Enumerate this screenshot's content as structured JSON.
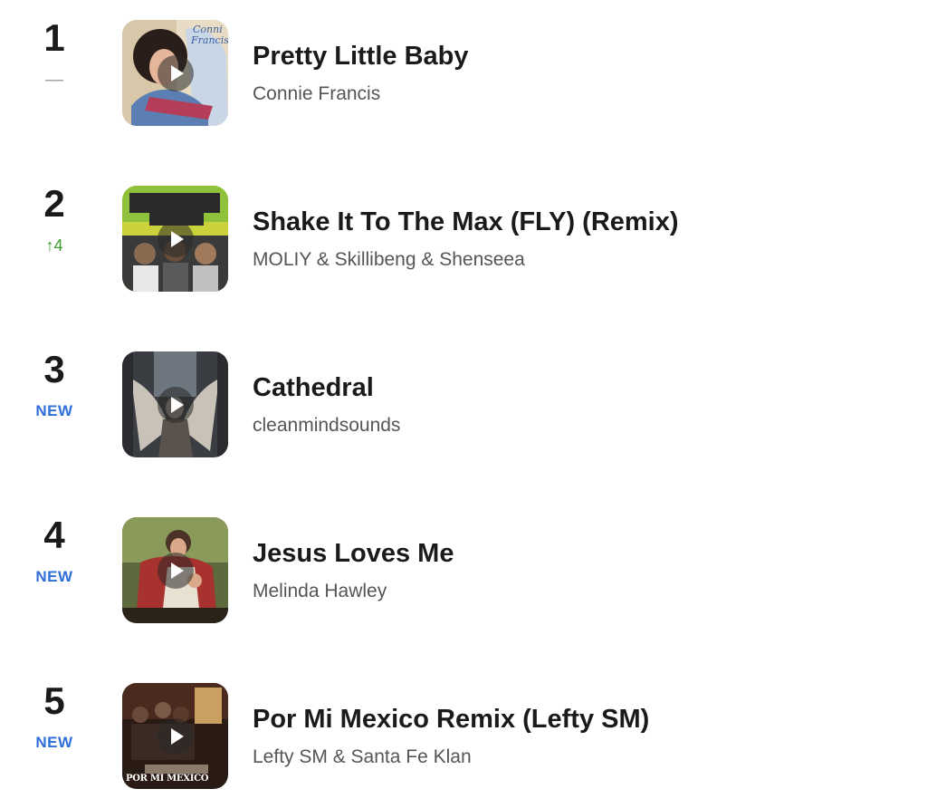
{
  "colors": {
    "rank_text": "#1a1a1a",
    "change_same": "#9a9a9a",
    "change_up": "#3a9a2a",
    "change_new": "#2f6fd8",
    "artist_text": "#555555"
  },
  "songs": [
    {
      "rank": "1",
      "change_label": "—",
      "change_type": "same",
      "title": "Pretty Little Baby",
      "artist": "Connie Francis",
      "artwork_icon": "play-icon"
    },
    {
      "rank": "2",
      "change_label": "↑4",
      "change_type": "up",
      "title": "Shake It To The Max (FLY) (Remix)",
      "artist": "MOLIY & Skillibeng & Shenseea",
      "artwork_icon": "play-icon"
    },
    {
      "rank": "3",
      "change_label": "NEW",
      "change_type": "new",
      "title": "Cathedral",
      "artist": "cleanmindsounds",
      "artwork_icon": "play-icon"
    },
    {
      "rank": "4",
      "change_label": "NEW",
      "change_type": "new",
      "title": "Jesus Loves Me",
      "artist": "Melinda Hawley",
      "artwork_icon": "play-icon"
    },
    {
      "rank": "5",
      "change_label": "NEW",
      "change_type": "new",
      "title": "Por Mi Mexico Remix (Lefty SM)",
      "artist": "Lefty SM & Santa Fe Klan",
      "artwork_icon": "play-icon",
      "artwork_caption": "POR MI MEXICO"
    }
  ]
}
